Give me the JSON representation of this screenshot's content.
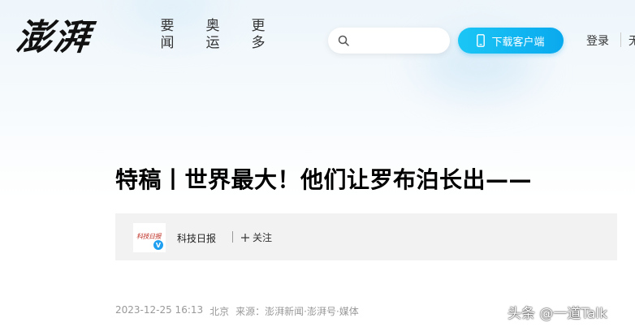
{
  "header": {
    "logo": "澎湃",
    "nav": [
      "要闻",
      "奥运",
      "更多"
    ],
    "search": {
      "placeholder": ""
    },
    "download_label": "下载客户端",
    "login_label": "登录",
    "extra_label": "无"
  },
  "article": {
    "title": "特稿丨世界最大！他们让罗布泊长出——",
    "author": {
      "avatar_text": "科技日报",
      "verified_mark": "V",
      "name": "科技日报",
      "follow_label": "关注"
    },
    "meta": {
      "datetime": "2023-12-25 16:13",
      "location": "北京",
      "source": "来源：澎湃新闻·澎湃号·媒体"
    }
  },
  "watermark": "头条 @一道Talk",
  "colors": {
    "accent": "#0aa9ee",
    "verified": "#1f9ff0",
    "author_box_bg": "#f2f2f2",
    "meta_text": "#999999"
  },
  "icons": {
    "search": "search-icon",
    "phone": "phone-icon",
    "plus": "plus-icon"
  }
}
